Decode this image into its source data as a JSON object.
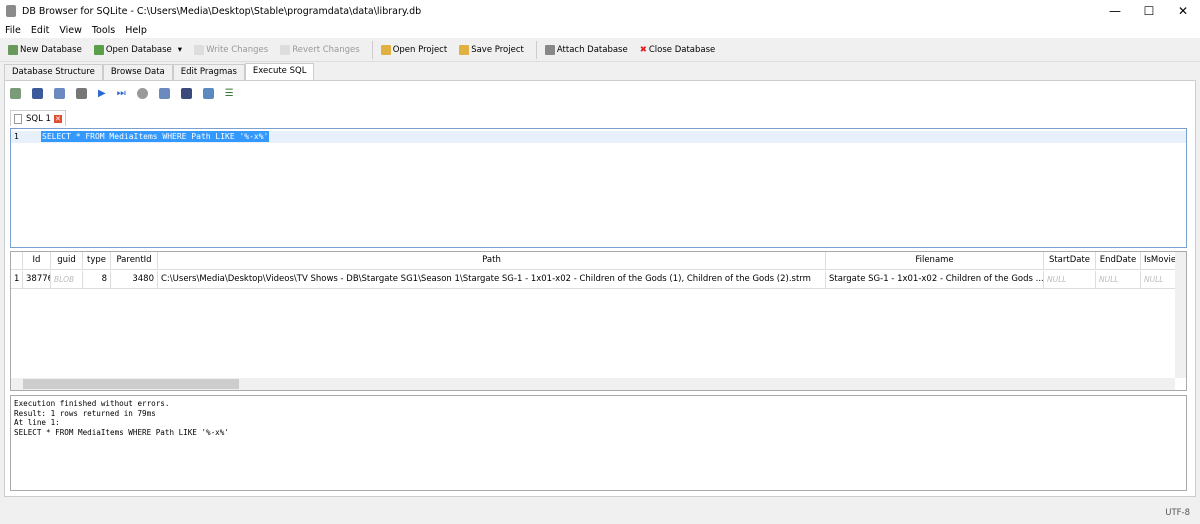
{
  "window": {
    "title": "DB Browser for SQLite - C:\\Users\\Media\\Desktop\\Stable\\programdata\\data\\library.db",
    "minimize": "—",
    "maximize": "☐",
    "close": "✕"
  },
  "menu": [
    "File",
    "Edit",
    "View",
    "Tools",
    "Help"
  ],
  "toolbar": {
    "new_db": "New Database",
    "open_db": "Open Database",
    "write": "Write Changes",
    "revert": "Revert Changes",
    "open_project": "Open Project",
    "save_project": "Save Project",
    "attach": "Attach Database",
    "close_db": "Close Database"
  },
  "tabs": [
    "Database Structure",
    "Browse Data",
    "Edit Pragmas",
    "Execute SQL"
  ],
  "sql_tab": {
    "label": "SQL 1",
    "close": "✕"
  },
  "editor": {
    "line_number": "1",
    "code": "SELECT * FROM MediaItems WHERE Path LIKE '%-x%'"
  },
  "grid": {
    "columns": [
      "Id",
      "guid",
      "type",
      "ParentId",
      "Path",
      "Filename",
      "StartDate",
      "EndDate",
      "IsMovie"
    ],
    "rows": [
      {
        "num": "1",
        "cells": [
          "38776",
          "BLOB",
          "8",
          "3480",
          "C:\\Users\\Media\\Desktop\\Videos\\TV Shows - DB\\Stargate SG1\\Season 1\\Stargate SG-1 - 1x01-x02 - Children of the Gods (1), Children of the Gods (2).strm",
          "Stargate SG-1 - 1x01-x02 - Children of the Gods ...",
          "NULL",
          "NULL",
          "NULL"
        ]
      }
    ]
  },
  "messages": "Execution finished without errors.\nResult: 1 rows returned in 79ms\nAt line 1:\nSELECT * FROM MediaItems WHERE Path LIKE '%-x%'",
  "status": {
    "encoding": "UTF-8"
  }
}
